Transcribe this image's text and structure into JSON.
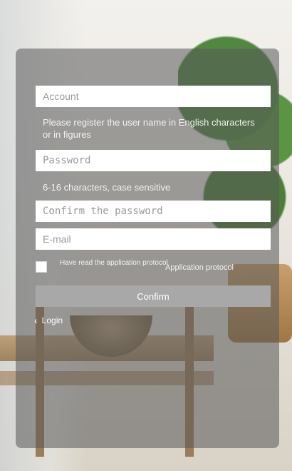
{
  "form": {
    "account_placeholder": "Account",
    "account_hint": "Please register the user name in English characters or in figures",
    "password_placeholder": "Password",
    "password_hint": "6-16 characters, case sensitive",
    "confirm_password_placeholder": "Confirm the password",
    "email_placeholder": "E-mail",
    "agree_text": "Have read the application protocol",
    "protocol_link": "Application protocol",
    "confirm_button": "Confirm",
    "login_link": "Login"
  },
  "icons": {
    "back": "chevron-left-icon"
  },
  "colors": {
    "panel_overlay": "#585858",
    "button": "#a8a8a8",
    "input_bg": "#ffffff",
    "text_light": "#f2f2f2"
  }
}
